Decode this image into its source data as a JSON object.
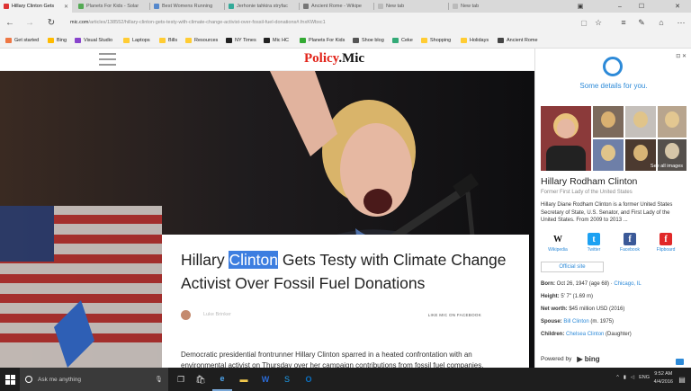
{
  "tabs": [
    {
      "label": "Hillary Clinton Gets",
      "active": true,
      "color": "#d33"
    },
    {
      "label": "Planets For Kids - Solar",
      "active": false,
      "color": "#5a5"
    },
    {
      "label": "Best Womens Running",
      "active": false,
      "color": "#58c"
    },
    {
      "label": "Jerhonie tahkira stryfac",
      "active": false,
      "color": "#3a9"
    },
    {
      "label": "Ancient Rome - Wikipe",
      "active": false,
      "color": "#777"
    },
    {
      "label": "New tab",
      "active": false,
      "color": "#bbb"
    },
    {
      "label": "New tab",
      "active": false,
      "color": "#bbb"
    }
  ],
  "window_controls": {
    "minimize": "–",
    "maximize": "☐",
    "close": "✕"
  },
  "address": {
    "host": "mic.com",
    "path": "/articles/138552/hillary-clinton-gets-testy-with-climate-change-activist-over-fossil-fuel-donations#.fnxKWbxc1"
  },
  "favorites": [
    {
      "label": "Get started",
      "color": "#e74"
    },
    {
      "label": "Bing",
      "color": "#fb0"
    },
    {
      "label": "Visual Studio",
      "color": "#84c"
    },
    {
      "label": "Laptops",
      "color": "#fc3"
    },
    {
      "label": "Bills",
      "color": "#fc3"
    },
    {
      "label": "Resources",
      "color": "#fc3"
    },
    {
      "label": "NY Times",
      "color": "#222"
    },
    {
      "label": "Mic HC",
      "color": "#222"
    },
    {
      "label": "Planets For Kids",
      "color": "#3a3"
    },
    {
      "label": "Shoe blog",
      "color": "#555"
    },
    {
      "label": "Ceke",
      "color": "#3a7"
    },
    {
      "label": "Shopping",
      "color": "#fc3"
    },
    {
      "label": "Holidays",
      "color": "#fc3"
    },
    {
      "label": "Ancient Rome",
      "color": "#444"
    }
  ],
  "site": {
    "logo_part1": "Policy",
    "logo_part2": ".Mic"
  },
  "article": {
    "headline_pre": "Hillary ",
    "headline_sel": "Clinton",
    "headline_post": " Gets Testy with Climate Change Activist Over Fossil Fuel Donations",
    "author": "Luke Brinker",
    "like_fb": "LIKE MIC ON FACEBOOK",
    "lede": "Democratic presidential frontrunner Hillary Clinton sparred in a heated confrontation with an environmental activist on Thursday over her campaign contributions from fossil fuel companies."
  },
  "cortana": {
    "tagline": "Some details for you.",
    "see_all": "See all images",
    "name": "Hillary Rodham Clinton",
    "subtitle": "Former First Lady of the United States",
    "description": "Hillary Diane Rodham Clinton is a former United States Secretary of State, U.S. Senator, and First Lady of the United States. From 2009 to 2013 ...",
    "social": [
      {
        "label": "Wikipedia",
        "glyph": "W",
        "bg": "#ffffff",
        "fg": "#111"
      },
      {
        "label": "Twitter",
        "glyph": "t",
        "bg": "#1da1f2",
        "fg": "#fff"
      },
      {
        "label": "Facebook",
        "glyph": "f",
        "bg": "#3b5998",
        "fg": "#fff"
      },
      {
        "label": "Flipboard",
        "glyph": "f",
        "bg": "#e12828",
        "fg": "#fff"
      }
    ],
    "official_site": "Official site",
    "facts": {
      "born_key": "Born:",
      "born_val": "Oct 26, 1947 (age 68)",
      "born_place": "Chicago, IL",
      "height_key": "Height:",
      "height_val": "5' 7\" (1.69 m)",
      "networth_key": "Net worth:",
      "networth_val": "$45 million USD (2016)",
      "spouse_key": "Spouse:",
      "spouse_link": "Bill Clinton",
      "spouse_rest": "(m. 1975)",
      "children_key": "Children:",
      "children_link": "Chelsea Clinton",
      "children_rest": "(Daughter)"
    },
    "powered_by": "Powered by",
    "bing": "bing"
  },
  "taskbar": {
    "search_placeholder": "Ask me anything",
    "time": "9:52 AM",
    "date": "4/4/2016",
    "lang": "ENG"
  }
}
